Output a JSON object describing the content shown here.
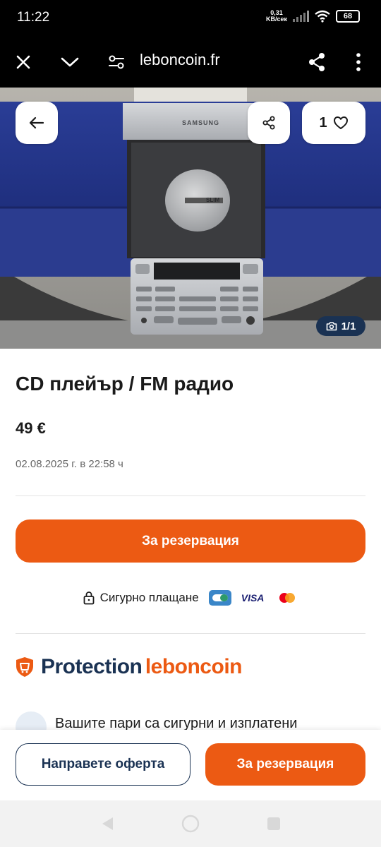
{
  "status_bar": {
    "time": "11:22",
    "net_speed_value": "0,31",
    "net_speed_unit": "KB/сек",
    "battery": "68"
  },
  "browser": {
    "url": "leboncoin.fr",
    "icons": [
      "close-icon",
      "chevron-down-icon",
      "site-settings-icon",
      "share-icon",
      "more-vert-icon"
    ]
  },
  "gallery": {
    "favorites_count": "1",
    "photo_counter": "1/1",
    "photo_brand_text": "SAMSUNG",
    "photo_disc_text": "SLIM"
  },
  "listing": {
    "title": "CD плейър / FM радио",
    "price": "49 €",
    "date": "02.08.2025 г. в 22:58 ч"
  },
  "reserve_main_label": "За резервация",
  "secure_payment": {
    "label": "Сигурно плащане",
    "visa_label": "VISA"
  },
  "protection": {
    "word": "Protection",
    "brand": "leboncoin"
  },
  "partial_text": "Вашите пари са сигурни и изплатени",
  "bottom_bar": {
    "offer_label": "Направете оферта",
    "reserve_label": "За резервация"
  },
  "colors": {
    "accent_orange": "#ec5a13",
    "navy": "#1a3253"
  }
}
